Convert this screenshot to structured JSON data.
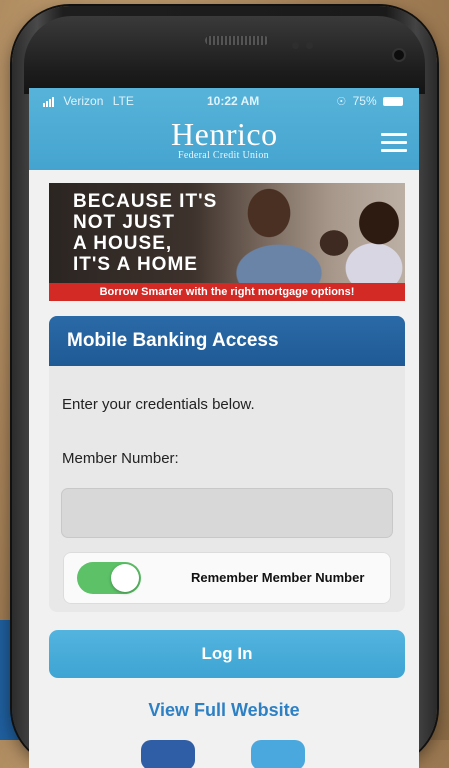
{
  "status_bar": {
    "carrier": "Verizon",
    "network": "LTE",
    "time": "10:22 AM",
    "battery": "75%"
  },
  "header": {
    "logo": "Henrico",
    "logo_sub": "Federal Credit Union"
  },
  "banner": {
    "line1": "BECAUSE IT'S",
    "line2": "NOT JUST",
    "line3": "A HOUSE,",
    "line4": "IT'S A HOME",
    "tagline": "Borrow Smarter with the right mortgage options!"
  },
  "login_card": {
    "title": "Mobile Banking Access",
    "instruction": "Enter your credentials below.",
    "member_label": "Member Number:",
    "member_value": "",
    "remember_label": "Remember Member Number",
    "remember_on": true
  },
  "actions": {
    "login_label": "Log In",
    "full_site_label": "View Full Website"
  },
  "colors": {
    "header_blue": "#45a4cf",
    "card_header": "#1f5a95",
    "toggle_green": "#5cc167",
    "banner_red": "#d42a26",
    "link_blue": "#2e80c4"
  }
}
